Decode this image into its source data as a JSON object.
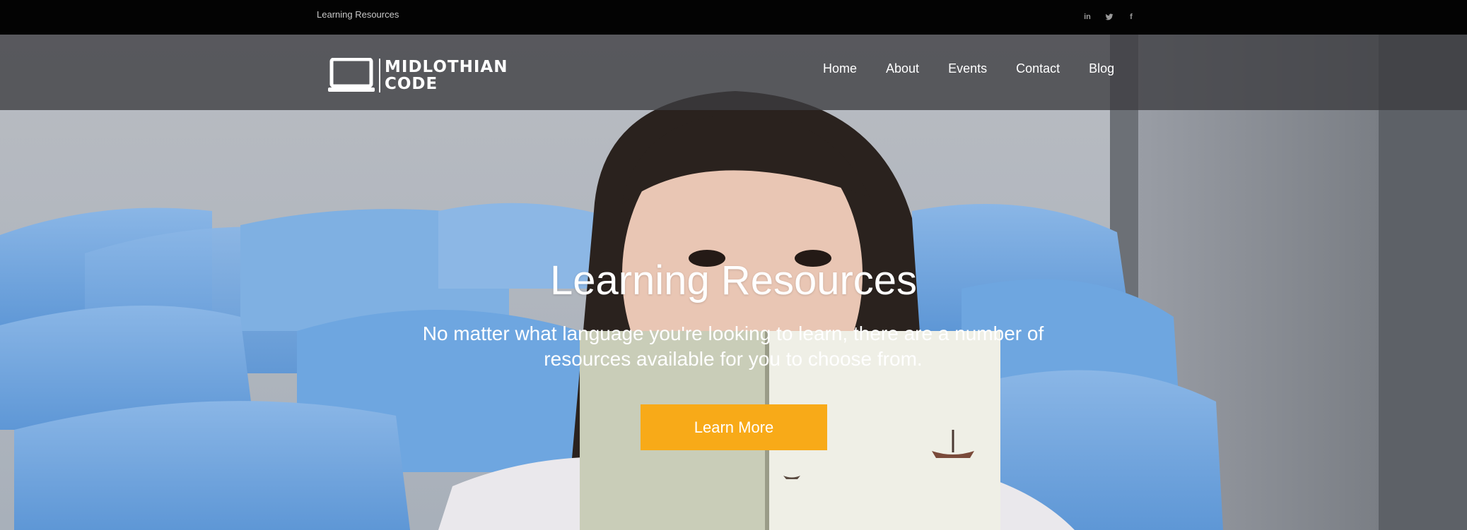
{
  "topbar": {
    "page_label": "Learning Resources",
    "social": [
      {
        "icon": "linkedin-icon",
        "glyph": "in"
      },
      {
        "icon": "twitter-icon",
        "glyph": ""
      },
      {
        "icon": "facebook-icon",
        "glyph": "f"
      }
    ]
  },
  "brand": {
    "line1": "MIDLOTHIAN",
    "line2": "CODE"
  },
  "nav": {
    "items": [
      {
        "label": "Home"
      },
      {
        "label": "About"
      },
      {
        "label": "Events"
      },
      {
        "label": "Contact"
      },
      {
        "label": "Blog"
      }
    ]
  },
  "hero": {
    "title": "Learning Resources",
    "subtitle": "No matter what language you're looking to learn, there are a number of resources available for you to choose from.",
    "cta_label": "Learn More"
  },
  "colors": {
    "accent": "#f8aa18",
    "topbar_bg": "#030303",
    "nav_overlay": "#3c3c40"
  }
}
